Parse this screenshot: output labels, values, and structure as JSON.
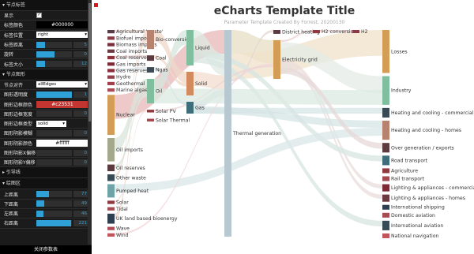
{
  "panel": {
    "folders": {
      "node_label": "节点标签",
      "node_style": "节点图形",
      "guide_lines": "引导线",
      "chart_area": "绘图区"
    },
    "rows": {
      "show": {
        "label": "显示",
        "checked": true
      },
      "label_color": {
        "label": "标签颜色",
        "value": "#000000",
        "color": "#000000"
      },
      "label_position": {
        "label": "标签位置",
        "value": "right"
      },
      "label_distance": {
        "label": "标签距离",
        "value": "5",
        "fraction": 0.25
      },
      "rotate": {
        "label": "旋转",
        "value": "0",
        "fraction": 0.5
      },
      "label_size": {
        "label": "标签大小",
        "value": "12",
        "fraction": 0.25
      },
      "node_align": {
        "label": "节点对齐",
        "value": "allEdges"
      },
      "node_opacity": {
        "label": "图形透明度",
        "value": "1",
        "fraction": 1.0
      },
      "border_color": {
        "label": "图形边框颜色",
        "value": "#c23531",
        "color": "#c23531"
      },
      "border_width": {
        "label": "图形边框宽度",
        "value": "0",
        "fraction": 0
      },
      "border_type": {
        "label": "图形边框类型",
        "value": "solid"
      },
      "shadow_blur": {
        "label": "图形阴影模糊",
        "value": "0",
        "fraction": 0
      },
      "shadow_color": {
        "label": "图形阴影颜色",
        "value": "#ffffff",
        "color": "#ffffff"
      },
      "shadow_offset_x": {
        "label": "图形阴影X偏移",
        "value": "0",
        "fraction": 0
      },
      "shadow_offset_y": {
        "label": "图形阴影Y偏移",
        "value": "0",
        "fraction": 0
      },
      "top": {
        "label": "上距离",
        "value": "77",
        "fraction": 0.35
      },
      "bottom": {
        "label": "下距离",
        "value": "49",
        "fraction": 0.22
      },
      "left": {
        "label": "左距离",
        "value": "46",
        "fraction": 0.21
      },
      "right": {
        "label": "右距离",
        "value": "221",
        "fraction": 0.98
      }
    },
    "close_label": "关闭参数表"
  },
  "chart": {
    "title": "eCharts Template Title",
    "subtitle": "Parameter Template Created By Forrest, 20200130",
    "columns": [
      [
        {
          "name": "Agricultural 'waste'",
          "color": "#5a3d4a"
        },
        {
          "name": "Biofuel imports",
          "color": "#8a3b45"
        },
        {
          "name": "Biomass imports",
          "color": "#7a2f3c"
        },
        {
          "name": "Coal imports",
          "color": "#6a3a40"
        },
        {
          "name": "Coal reserves",
          "color": "#8e3038"
        },
        {
          "name": "Gas imports",
          "color": "#7c2a35"
        },
        {
          "name": "Gas reserves",
          "color": "#8a2f3a"
        },
        {
          "name": "Hydro",
          "color": "#93404a"
        },
        {
          "name": "Geothermal",
          "color": "#a0404a"
        },
        {
          "name": "Marine algae",
          "color": "#a84b53"
        },
        {
          "name": "Nuclear",
          "color": "#d39d55"
        },
        {
          "name": "Oil imports",
          "color": "#a3a98a"
        },
        {
          "name": "Oil reserves",
          "color": "#5b3b3f"
        },
        {
          "name": "Other waste",
          "color": "#374a55"
        },
        {
          "name": "Pumped heat",
          "color": "#6ea4a8"
        },
        {
          "name": "Solar",
          "color": "#8f3a3f"
        },
        {
          "name": "Tidal",
          "color": "#a34a50"
        },
        {
          "name": "UK land based bioenergy",
          "color": "#2e3f52"
        },
        {
          "name": "Wave",
          "color": "#b04a55"
        },
        {
          "name": "Wind",
          "color": "#c2555c"
        }
      ],
      [
        {
          "name": "Bio-conversion",
          "color": "#b7836e"
        },
        {
          "name": "Coal",
          "color": "#5b3b3f"
        },
        {
          "name": "Ngas",
          "color": "#3d4a55"
        },
        {
          "name": "Oil",
          "color": "#7fbf9f"
        },
        {
          "name": "Solar PV",
          "color": "#8f3a3f"
        },
        {
          "name": "Solar Thermal",
          "color": "#a34a50"
        }
      ],
      [
        {
          "name": "Liquid",
          "color": "#7fbf9f"
        },
        {
          "name": "Solid",
          "color": "#d38a5f"
        },
        {
          "name": "Gas",
          "color": "#3e6e7a"
        }
      ],
      [
        {
          "name": "Thermal generation",
          "color": "#b8c8d0"
        }
      ],
      [
        {
          "name": "District heating",
          "color": "#5b3b3f"
        },
        {
          "name": "Electricity grid",
          "color": "#d39d55"
        }
      ],
      [
        {
          "name": "H2 conversion",
          "color": "#8f3a3f"
        }
      ],
      [
        {
          "name": "H2",
          "color": "#8a3b45"
        }
      ],
      [
        {
          "name": "Losses",
          "color": "#d39d55"
        },
        {
          "name": "Industry",
          "color": "#7fbf9f"
        },
        {
          "name": "Heating and cooling - commercial",
          "color": "#374a55"
        },
        {
          "name": "Heating and cooling - homes",
          "color": "#b7836e"
        },
        {
          "name": "Over generation / exports",
          "color": "#5b3b3f"
        },
        {
          "name": "Road transport",
          "color": "#3e6e7a"
        },
        {
          "name": "Agriculture",
          "color": "#8f3a3f"
        },
        {
          "name": "Rail transport",
          "color": "#a34a50"
        },
        {
          "name": "Lighting & appliances - commercial",
          "color": "#7c2a35"
        },
        {
          "name": "Lighting & appliances - homes",
          "color": "#6a3a40"
        },
        {
          "name": "International shipping",
          "color": "#2e3f52"
        },
        {
          "name": "Domestic aviation",
          "color": "#a84b53"
        },
        {
          "name": "International aviation",
          "color": "#374a55"
        },
        {
          "name": "National navigation",
          "color": "#c2555c"
        }
      ]
    ]
  }
}
